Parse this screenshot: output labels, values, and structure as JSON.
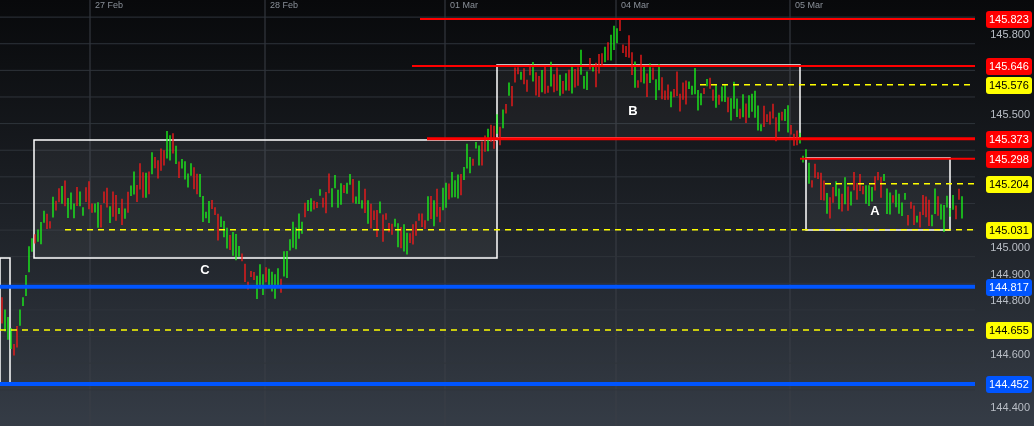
{
  "date_labels": [
    "27 Feb",
    "28 Feb",
    "01 Mar",
    "04 Mar",
    "05 Mar"
  ],
  "price_axis": {
    "ticks": [
      "145.800",
      "145.500",
      "145.000",
      "144.900",
      "144.800",
      "144.600",
      "144.400"
    ]
  },
  "levels": [
    {
      "price": "145.823",
      "kind": "solid",
      "color": "#ff0000"
    },
    {
      "price": "145.646",
      "kind": "solid",
      "color": "#ff0000"
    },
    {
      "price": "145.576",
      "kind": "dashed",
      "color": "#ffff00"
    },
    {
      "price": "145.373",
      "kind": "solid",
      "color": "#ff0000"
    },
    {
      "price": "145.298",
      "kind": "solid",
      "color": "#ff0000"
    },
    {
      "price": "145.204",
      "kind": "dashed",
      "color": "#ffff00"
    },
    {
      "price": "145.031",
      "kind": "dashed",
      "color": "#ffff00"
    },
    {
      "price": "144.817",
      "kind": "solid",
      "color": "#0055ff"
    },
    {
      "price": "144.655",
      "kind": "dashed",
      "color": "#ffff00"
    },
    {
      "price": "144.452",
      "kind": "solid",
      "color": "#0055ff"
    }
  ],
  "zones": [
    {
      "label": "C"
    },
    {
      "label": "B"
    },
    {
      "label": "A"
    }
  ]
}
